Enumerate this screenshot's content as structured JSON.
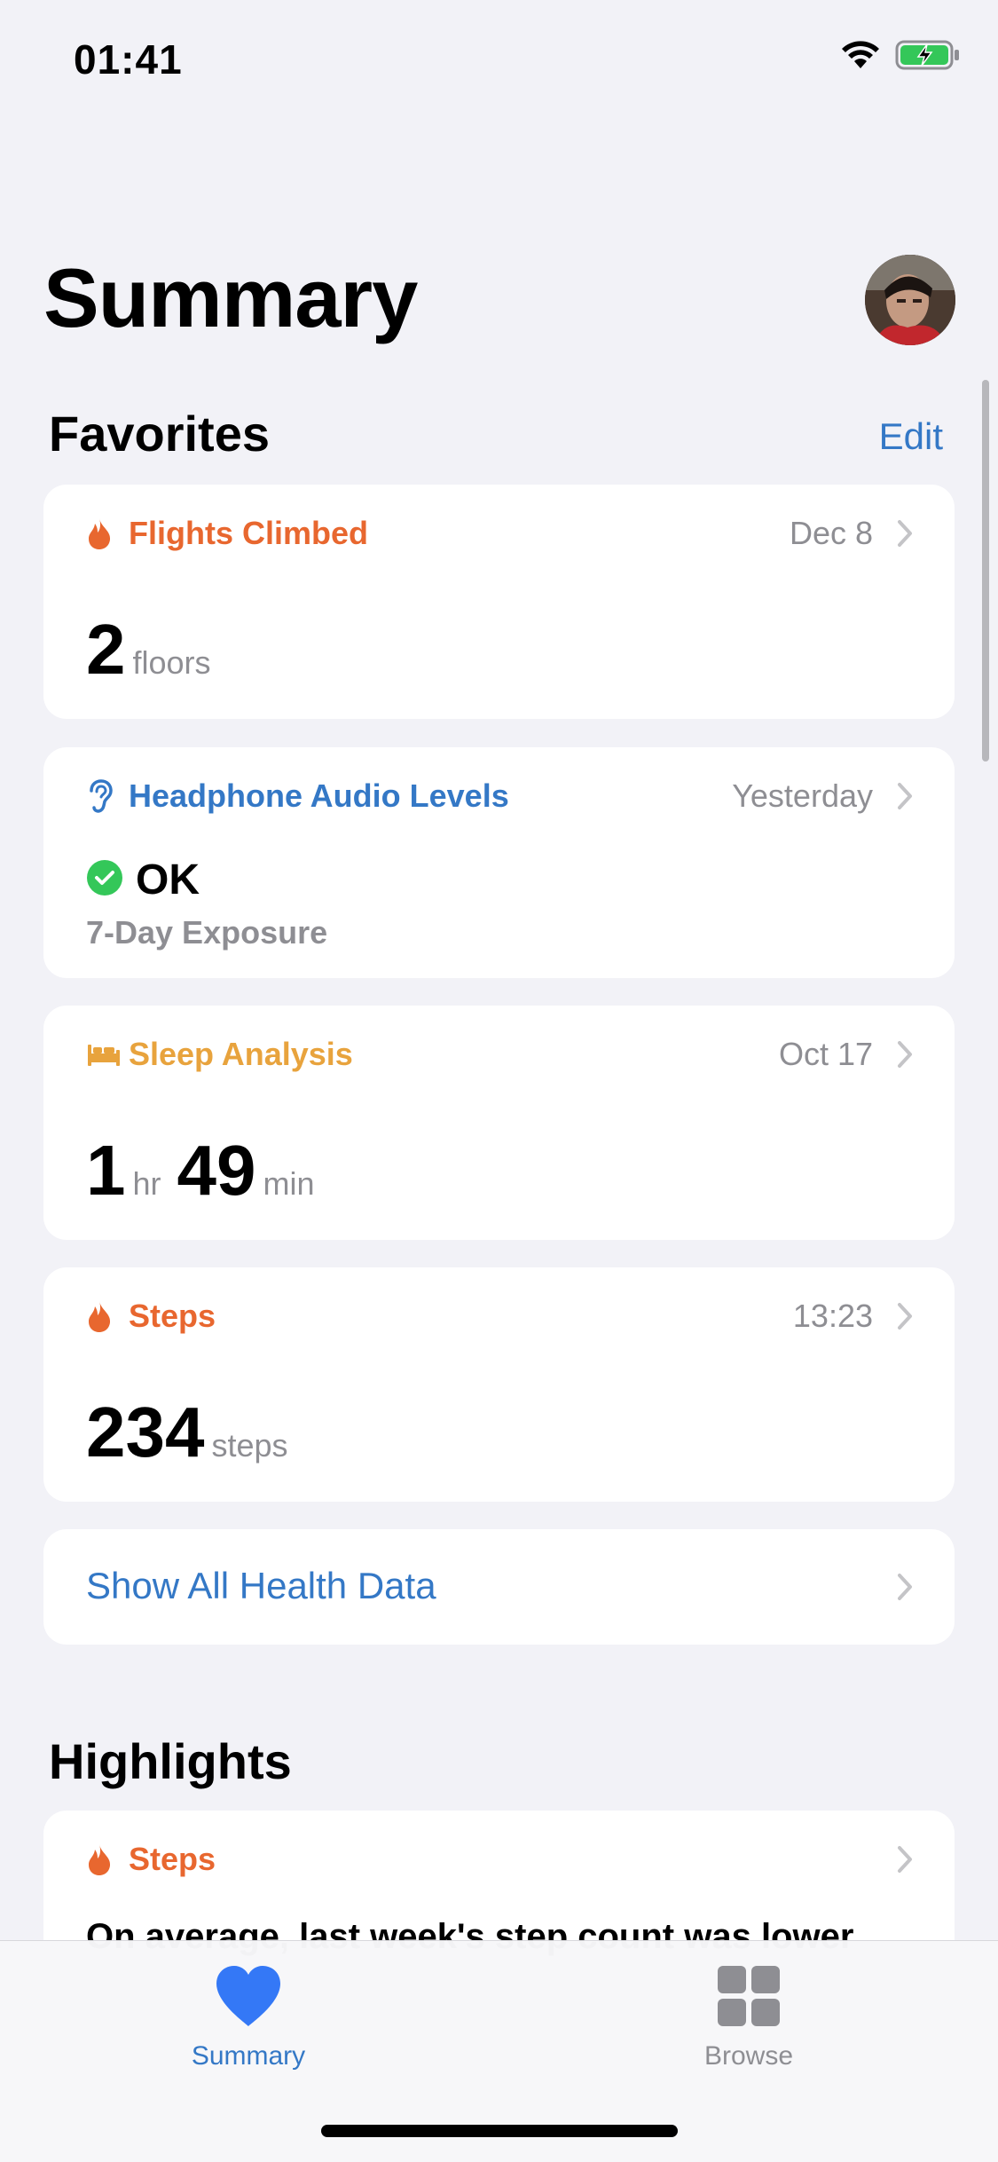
{
  "status_bar": {
    "time": "01:41"
  },
  "header": {
    "title": "Summary"
  },
  "favorites": {
    "title": "Favorites",
    "edit_label": "Edit",
    "cards": [
      {
        "title": "Flights Climbed",
        "date": "Dec 8",
        "value": "2",
        "unit": "floors",
        "color": "#e8672f",
        "icon": "flame-icon"
      },
      {
        "title": "Headphone Audio Levels",
        "date": "Yesterday",
        "status": "OK",
        "subtitle": "7-Day Exposure",
        "color": "#3478c6",
        "icon": "ear-icon"
      },
      {
        "title": "Sleep Analysis",
        "date": "Oct 17",
        "hours": "1",
        "hours_unit": "hr",
        "minutes": "49",
        "minutes_unit": "min",
        "color": "#e8a33d",
        "icon": "bed-icon"
      },
      {
        "title": "Steps",
        "date": "13:23",
        "value": "234",
        "unit": "steps",
        "color": "#e8672f",
        "icon": "flame-icon"
      }
    ],
    "show_all_label": "Show All Health Data"
  },
  "highlights": {
    "title": "Highlights",
    "card": {
      "title": "Steps",
      "text": "On average, last week's step count was lower",
      "color": "#e8672f",
      "icon": "flame-icon"
    }
  },
  "tab_bar": {
    "tabs": [
      {
        "label": "Summary",
        "icon": "heart-icon",
        "active": true
      },
      {
        "label": "Browse",
        "icon": "grid-icon",
        "active": false
      }
    ]
  },
  "colors": {
    "accent": "#3478c6",
    "background": "#f2f2f7",
    "ok_green": "#34c759"
  }
}
